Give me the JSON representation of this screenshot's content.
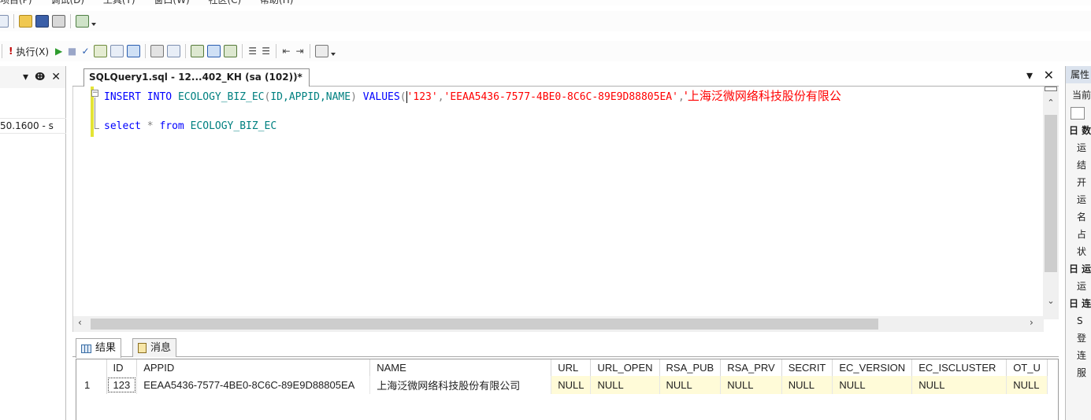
{
  "menu": {
    "items": [
      "项目(P)",
      "调试(D)",
      "工具(T)",
      "窗口(W)",
      "社区(C)",
      "帮助(H)"
    ]
  },
  "toolbar2": {
    "execute_label": "执行(X)"
  },
  "object_explorer": {
    "server_fragment": "50.1600 - s"
  },
  "document_tab": {
    "title": "SQLQuery1.sql - 12...402_KH (sa (102))*"
  },
  "editor": {
    "line1": {
      "insert": "INSERT",
      "into": "INTO",
      "table": "ECOLOGY_BIZ_EC",
      "open_paren": "(",
      "columns": "ID,APPID,NAME",
      "close_paren": ")",
      "values": "VALUES",
      "values_open": "(",
      "val_id": "'123'",
      "comma1": ",",
      "val_appid": "'EEAA5436-7577-4BE0-8C6C-89E9D88805EA'",
      "comma2": ",",
      "val_name_start": "'上海泛微网络科技股份有限公"
    },
    "line2": {
      "select": "select",
      "star": "*",
      "from": "from",
      "table": "ECOLOGY_BIZ_EC"
    }
  },
  "results": {
    "tabs": [
      "结果",
      "消息"
    ],
    "columns": [
      "ID",
      "APPID",
      "NAME",
      "URL",
      "URL_OPEN",
      "RSA_PUB",
      "RSA_PRV",
      "SECRIT",
      "EC_VERSION",
      "EC_ISCLUSTER",
      "OT_U"
    ],
    "rows": [
      {
        "num": "1",
        "cells": [
          "123",
          "EEAA5436-7577-4BE0-8C6C-89E9D88805EA",
          "上海泛微网络科技股份有限公司",
          "NULL",
          "NULL",
          "NULL",
          "NULL",
          "NULL",
          "NULL",
          "NULL",
          "NULL"
        ]
      }
    ]
  },
  "properties": {
    "title": "属性",
    "current": "当前",
    "cat1": "日 数",
    "row1": "运",
    "row2": "结",
    "row3": "开",
    "row4": "运",
    "row5": "名",
    "row6": "占",
    "row7": "状",
    "cat2": "日 运",
    "row8": "运",
    "cat3": "日 连",
    "row9": "S",
    "row10": "登",
    "row11": "连",
    "row12": "服"
  },
  "colors": {
    "keyword": "#0000ff",
    "identifier": "#008080",
    "string": "#ff0000",
    "null_cell": "#fffbd8",
    "modified_margin": "#e4e435"
  }
}
